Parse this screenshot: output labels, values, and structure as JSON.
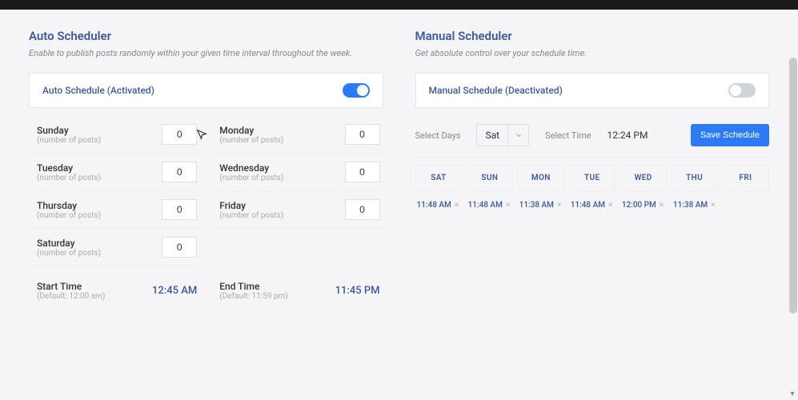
{
  "auto": {
    "title": "Auto Scheduler",
    "subtitle": "Enable to publish posts randomly within your given time interval throughout the week.",
    "status_label": "Auto Schedule (Activated)",
    "days": [
      {
        "name": "Sunday",
        "sub": "(number of posts)",
        "value": "0"
      },
      {
        "name": "Monday",
        "sub": "(number of posts)",
        "value": "0"
      },
      {
        "name": "Tuesday",
        "sub": "(number of posts)",
        "value": "0"
      },
      {
        "name": "Wednesday",
        "sub": "(number of posts)",
        "value": "0"
      },
      {
        "name": "Thursday",
        "sub": "(number of posts)",
        "value": "0"
      },
      {
        "name": "Friday",
        "sub": "(number of posts)",
        "value": "0"
      },
      {
        "name": "Saturday",
        "sub": "(number of posts)",
        "value": "0"
      }
    ],
    "start_label": "Start Time",
    "start_sub": "(Default: 12:00 am)",
    "start_value": "12:45 AM",
    "end_label": "End Time",
    "end_sub": "(Default: 11:59 pm)",
    "end_value": "11:45 PM"
  },
  "manual": {
    "title": "Manual Scheduler",
    "subtitle": "Get absolute control over your schedule time.",
    "status_label": "Manual Schedule (Deactivated)",
    "select_days_label": "Select Days",
    "select_days_value": "Sat",
    "select_time_label": "Select Time",
    "select_time_value": "12:24 PM",
    "save_label": "Save Schedule",
    "tabs": [
      "SAT",
      "SUN",
      "MON",
      "TUE",
      "WED",
      "THU",
      "FRI"
    ],
    "times": [
      "11:48 AM",
      "11:48 AM",
      "11:38 AM",
      "11:48 AM",
      "12:00 PM",
      "11:38 AM",
      ""
    ]
  }
}
